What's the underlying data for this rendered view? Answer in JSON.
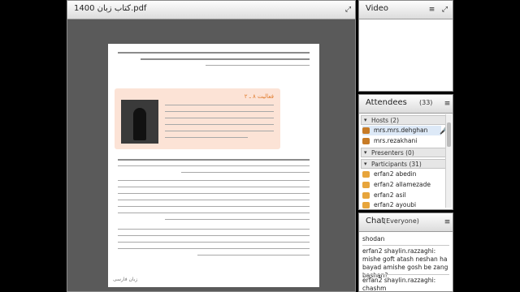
{
  "document_pod": {
    "title": "کتاب زبان 1400.pdf",
    "page": {
      "activity_heading": "فعالیت ۸ ـ ۲",
      "footer": "زبان فارسی"
    }
  },
  "video_pod": {
    "title": "Video"
  },
  "attendees_pod": {
    "title": "Attendees",
    "count": "(33)",
    "hosts_header": "Hosts (2)",
    "hosts": [
      "mrs.mrs.dehghan",
      "mrs.rezakhani"
    ],
    "presenters_header": "Presenters (0)",
    "participants_header": "Participants (31)",
    "participants": [
      "erfan2 abedin",
      "erfan2 allamezade",
      "erfan2 asil",
      "erfan2 ayoubi"
    ]
  },
  "chat_pod": {
    "title": "Chat",
    "audience": "(Everyone)",
    "messages": [
      {
        "text": "shodan"
      },
      {
        "sender": "erfan2 shaylin.razzaghi:",
        "text": "mishe goft atash neshan ha bayad amishe gosh be zang bashan?"
      },
      {
        "sender": "erfan2 shaylin.razzaghi:",
        "text": "chashm"
      }
    ]
  },
  "colors": {
    "host_icon": "#c77b26",
    "participant_icon": "#e7a53c",
    "activity_box": "#fce3d6"
  }
}
